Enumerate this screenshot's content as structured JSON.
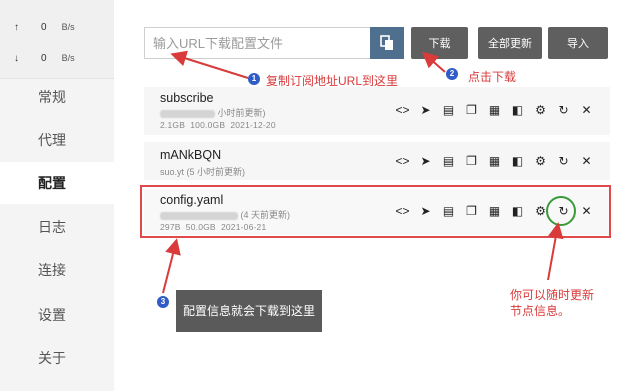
{
  "window": {
    "pin": "📌",
    "minimize": "–",
    "maximize": "☐",
    "close": "✕"
  },
  "traffic": {
    "up": {
      "arrow": "↑",
      "value": "0",
      "unit": "B/s"
    },
    "down": {
      "arrow": "↓",
      "value": "0",
      "unit": "B/s"
    }
  },
  "nav": {
    "items": [
      {
        "label": "常规"
      },
      {
        "label": "代理"
      },
      {
        "label": "配置"
      },
      {
        "label": "日志"
      },
      {
        "label": "连接"
      },
      {
        "label": "设置"
      },
      {
        "label": "关于"
      }
    ],
    "active": "配置"
  },
  "toolbar": {
    "url_placeholder": "输入URL下载配置文件",
    "download_label": "下载",
    "update_all_label": "全部更新",
    "import_label": "导入"
  },
  "profiles": [
    {
      "name": "subscribe",
      "updated": "小时前更新)",
      "size": "2.1GB",
      "total": "100.0GB",
      "date": "2021-12-20"
    },
    {
      "name": "mANkBQN",
      "updated": "suo.yt (5 小时前更新)"
    },
    {
      "name": "config.yaml",
      "updated": "(4 天前更新)",
      "size": "297B",
      "total": "50.0GB",
      "date": "2021-06-21"
    }
  ],
  "annotations": {
    "step1": {
      "badge": "1",
      "text": "复制订阅地址URL到这里"
    },
    "step2": {
      "badge": "2",
      "text": "点击下载"
    },
    "step3": {
      "badge": "3",
      "text": "配置信息就会下载到这里"
    },
    "note_line1": "你可以随时更新",
    "note_line2": "节点信息。"
  },
  "colors": {
    "annotation_red": "#d93a3a",
    "badge_blue": "#2f5cc7",
    "highlight_green": "#3a9a3a",
    "button_gray": "#5f5f5f"
  }
}
